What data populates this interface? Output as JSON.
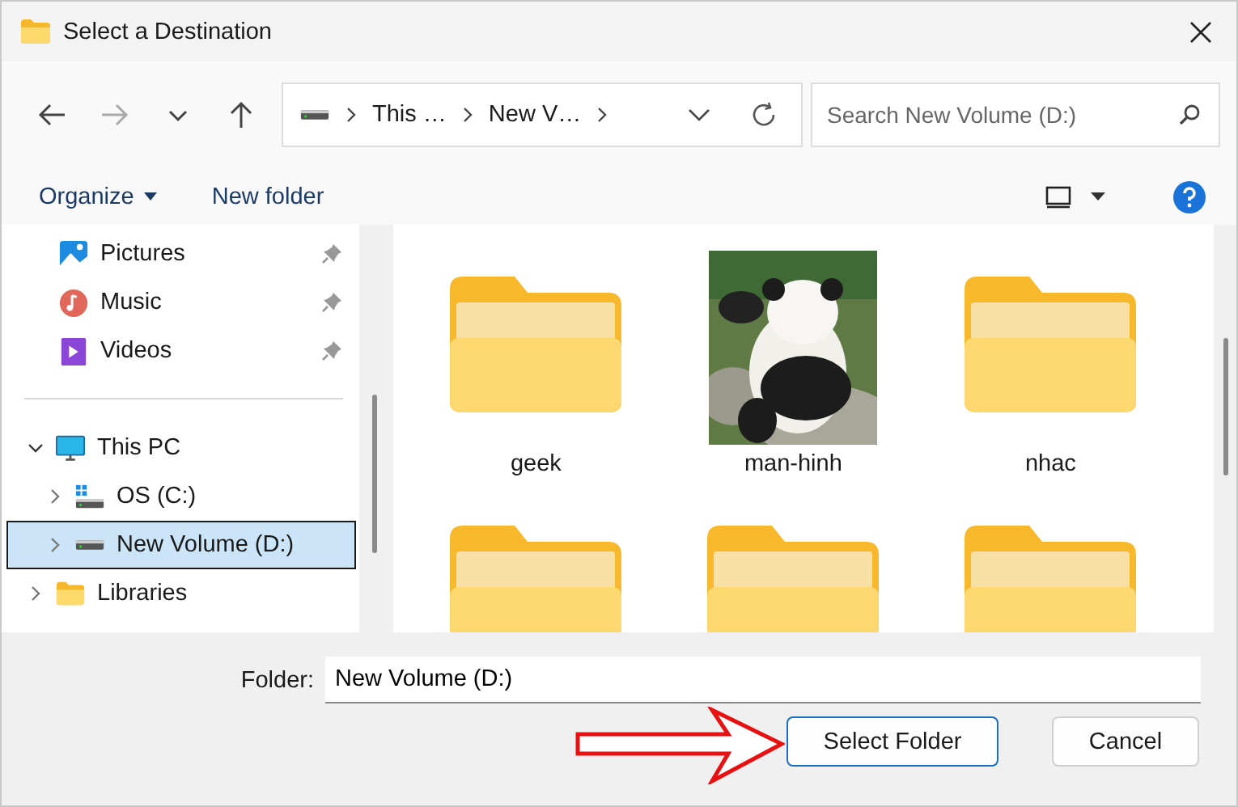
{
  "window": {
    "title": "Select a Destination"
  },
  "nav_buttons": [
    {
      "kind": "back",
      "disabled": false
    },
    {
      "kind": "forward",
      "disabled": true
    },
    {
      "kind": "recent",
      "disabled": false
    },
    {
      "kind": "up",
      "disabled": false
    }
  ],
  "breadcrumb": [
    "This …",
    "New V…"
  ],
  "search": {
    "placeholder": "Search New Volume (D:)"
  },
  "toolbar": {
    "organize": "Organize",
    "new_folder": "New folder"
  },
  "sidebar": {
    "quick_access": [
      {
        "label": "Pictures",
        "kind": "pictures",
        "pinned": true
      },
      {
        "label": "Music",
        "kind": "music",
        "pinned": true
      },
      {
        "label": "Videos",
        "kind": "videos",
        "pinned": true
      }
    ],
    "tree": [
      {
        "label": "This PC",
        "kind": "pc",
        "expanded": true,
        "selected": false,
        "children": [
          {
            "label": "OS (C:)",
            "kind": "osdrive",
            "expanded": false,
            "selected": false
          },
          {
            "label": "New Volume (D:)",
            "kind": "drive",
            "expanded": false,
            "selected": true
          }
        ]
      },
      {
        "label": "Libraries",
        "kind": "folder",
        "expanded": false,
        "selected": false
      }
    ]
  },
  "files": [
    {
      "name": "geek",
      "kind": "folder"
    },
    {
      "name": "man-hinh",
      "kind": "picture"
    },
    {
      "name": "nhac",
      "kind": "folder"
    },
    {
      "kind": "folder"
    },
    {
      "kind": "folder"
    },
    {
      "kind": "folder"
    }
  ],
  "folder_field": {
    "label": "Folder:",
    "value": "New Volume (D:)"
  },
  "buttons": [
    {
      "label": "Select Folder",
      "default": true
    },
    {
      "label": "Cancel",
      "default": false
    }
  ]
}
